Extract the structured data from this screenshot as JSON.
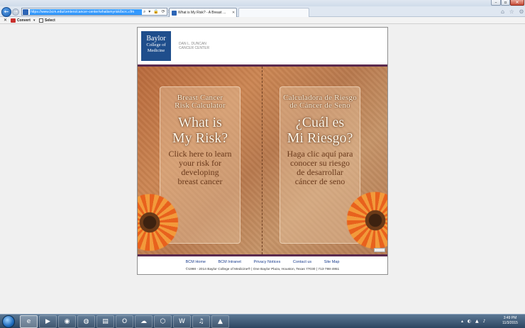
{
  "window": {
    "minimize_glyph": "–",
    "maximize_glyph": "▫",
    "close_glyph": "✕"
  },
  "browser": {
    "back_glyph": "←",
    "forward_glyph": "→",
    "address": "https://www.bcm.edu/centers/cancer-center/whatismyrisk/bcrc.cfm",
    "address_tools": "⌕ ▾ 🔒 ⟳ ✕",
    "active_tab_title": "What is My Risk? - A Breast ...",
    "tab_close_glyph": "✕",
    "nav_icons": "⌂ ☆ ⚙"
  },
  "command_bar": {
    "close_glyph": "✕",
    "convert_label": "Convert",
    "convert_caret": "▾",
    "select_label": "Select"
  },
  "header": {
    "logo_line1": "Baylor",
    "logo_line2": "College of",
    "logo_line3": "Medicine",
    "center_line1": "DAN L. DUNCAN",
    "center_line2": "CANCER CENTER"
  },
  "panels": {
    "english": {
      "heading_line1": "Breast Cancer",
      "heading_line2": "Risk Calculator",
      "question_line1": "What is",
      "question_line2": "My Risk?",
      "cta_line1": "Click here to learn",
      "cta_line2": "your risk for",
      "cta_line3": "developing",
      "cta_line4": "breast cancer"
    },
    "spanish": {
      "heading_line1": "Calculadora de Riesgo",
      "heading_line2": "de Cáncer de Seno",
      "question_line1": "¿Cuál es",
      "question_line2": "Mi Riesgo?",
      "cta_line1": "Haga clic aquí para",
      "cta_line2": "conocer su riesgo",
      "cta_line3": "de desarrollar",
      "cta_line4": "cáncer de seno"
    }
  },
  "footer": {
    "links": [
      "BCM Home",
      "BCM Intranet",
      "Privacy Notices",
      "Contact us",
      "Site Map"
    ],
    "copyright": "©1998 - 2014 Baylor College of Medicine® | One Baylor Plaza, Houston, Texas 77030 | 713-798-4951"
  },
  "taskbar": {
    "apps": [
      "e",
      "▶",
      "◉",
      "◍",
      "▤",
      "O",
      "☁",
      "⬡",
      "W",
      "♫",
      "▲"
    ],
    "tray": "▴ ◐ ▲ ♪",
    "time": "3:49 PM",
    "date": "11/3/2015"
  },
  "colors": {
    "brand_blue": "#1f4e8c",
    "rule_purple": "#5b2a4e",
    "link_blue": "#1a3c8c"
  }
}
